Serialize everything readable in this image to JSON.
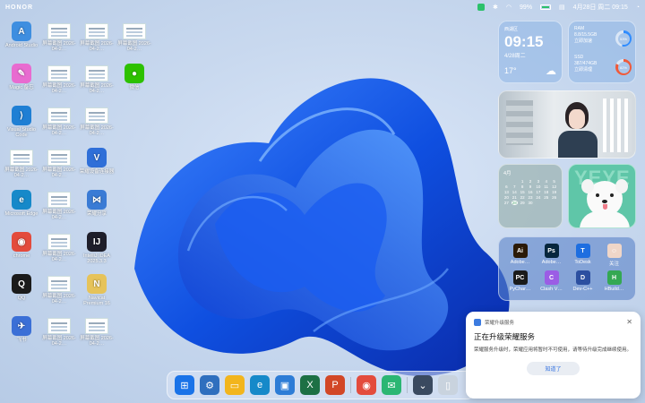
{
  "topbar": {
    "brand": "HONOR",
    "battery": "99%",
    "datetime": "4月28日 周二 09:15"
  },
  "desktop_icons": [
    {
      "label": "Android Studio",
      "icon": "android-studio-icon",
      "color": "#3e8ee0",
      "glyph": "A"
    },
    {
      "label": "屏幕截图 2026-04-2…",
      "icon": "screenshot-thumb",
      "thumb": true
    },
    {
      "label": "屏幕截图 2026-04-2…",
      "icon": "screenshot-thumb",
      "thumb": true
    },
    {
      "label": "屏幕截图 2026-04-2…",
      "icon": "screenshot-thumb",
      "thumb": true
    },
    {
      "label": "Magic 备忘",
      "icon": "magic-notes-icon",
      "color": "#e86bd0",
      "glyph": "✎"
    },
    {
      "label": "屏幕截图 2026-04-2…",
      "icon": "screenshot-thumb",
      "thumb": true
    },
    {
      "label": "屏幕截图 2026-04-2…",
      "icon": "screenshot-thumb",
      "thumb": true
    },
    {
      "label": "微信",
      "icon": "wechat-icon",
      "color": "#2dc100",
      "glyph": "●"
    },
    {
      "label": "Visual Studio Code",
      "icon": "vscode-icon",
      "color": "#1f7fd4",
      "glyph": "⟩"
    },
    {
      "label": "屏幕截图 2026-04-2…",
      "icon": "screenshot-thumb",
      "thumb": true
    },
    {
      "label": "屏幕截图 2026-04-2…",
      "icon": "screenshot-thumb",
      "thumb": true
    },
    {
      "label": "",
      "icon": "empty",
      "thumb": false,
      "hidden": true
    },
    {
      "label": "屏幕截图 2026-04-2…",
      "icon": "screenshot-thumb",
      "thumb": true
    },
    {
      "label": "屏幕截图 2026-04-2…",
      "icon": "screenshot-thumb",
      "thumb": true
    },
    {
      "label": "荣耀设备连接器",
      "icon": "honor-connect-icon",
      "color": "#2f6fd8",
      "glyph": "V"
    },
    {
      "label": "",
      "icon": "empty",
      "thumb": false,
      "hidden": true
    },
    {
      "label": "Microsoft Edge",
      "icon": "edge-icon",
      "color": "#1689c9",
      "glyph": "e"
    },
    {
      "label": "屏幕截图 2026-04-2…",
      "icon": "screenshot-thumb",
      "thumb": true
    },
    {
      "label": "荣耀分享",
      "icon": "honor-share-icon",
      "color": "#3a7bd5",
      "glyph": "⋈"
    },
    {
      "label": "",
      "icon": "empty",
      "thumb": false,
      "hidden": true
    },
    {
      "label": "chrome",
      "icon": "chrome-icon",
      "color": "#e34b3c",
      "glyph": "◉"
    },
    {
      "label": "屏幕截图 2026-04-2…",
      "icon": "screenshot-thumb",
      "thumb": true
    },
    {
      "label": "IntelliJ IDEA 2025.3.3",
      "icon": "intellij-icon",
      "color": "#1e1e2a",
      "glyph": "IJ"
    },
    {
      "label": "",
      "icon": "empty",
      "thumb": false,
      "hidden": true
    },
    {
      "label": "QQ",
      "icon": "qq-icon",
      "color": "#1b1b1b",
      "glyph": "Q"
    },
    {
      "label": "屏幕截图 2026-04-2…",
      "icon": "screenshot-thumb",
      "thumb": true
    },
    {
      "label": "Navicat Premium 16",
      "icon": "navicat-icon",
      "color": "#e6c35a",
      "glyph": "N"
    },
    {
      "label": "",
      "icon": "empty",
      "thumb": false,
      "hidden": true
    },
    {
      "label": "飞书",
      "icon": "feishu-icon",
      "color": "#3b6fd6",
      "glyph": "✈"
    },
    {
      "label": "屏幕截图 2026-04-2…",
      "icon": "screenshot-thumb",
      "thumb": true
    },
    {
      "label": "屏幕截图 2026-04-2…",
      "icon": "screenshot-thumb",
      "thumb": true
    },
    {
      "label": "",
      "icon": "empty",
      "thumb": false,
      "hidden": true
    }
  ],
  "weather": {
    "location": "西湖区",
    "time": "09:15",
    "date": "4/28周二",
    "temp": "17°"
  },
  "system": {
    "ram_label": "RAM",
    "ram_value": "8.8/15.5GB",
    "ram_action": "立即加速",
    "ram_pct": "53%",
    "ram_fill": 0.53,
    "ssd_label": "SSD",
    "ssd_value": "387/474GB",
    "ssd_action": "立即清理",
    "ssd_pct": "82%",
    "ssd_fill": 0.82
  },
  "calendar": {
    "month": "4月",
    "days": [
      "",
      "",
      "1",
      "2",
      "3",
      "4",
      "5",
      "6",
      "7",
      "8",
      "9",
      "10",
      "11",
      "12",
      "13",
      "14",
      "15",
      "16",
      "17",
      "18",
      "19",
      "20",
      "21",
      "22",
      "23",
      "24",
      "25",
      "26",
      "27",
      "28",
      "29",
      "30",
      "",
      "",
      ""
    ],
    "today": "28"
  },
  "photo_widget": {
    "text": "YEYE"
  },
  "apps_widget": [
    {
      "label": "Adobe…",
      "icon": "illustrator-icon",
      "color": "#2b1a07",
      "glyph": "Ai"
    },
    {
      "label": "Adobe…",
      "icon": "photoshop-icon",
      "color": "#06263d",
      "glyph": "Ps"
    },
    {
      "label": "ToDesk",
      "icon": "todesk-icon",
      "color": "#1e6ee0",
      "glyph": "T"
    },
    {
      "label": "关注",
      "icon": "avatar-icon",
      "color": "#f0d6c8",
      "glyph": "☺"
    },
    {
      "label": "PyChar…",
      "icon": "pycharm-icon",
      "color": "#1a1a1a",
      "glyph": "PC"
    },
    {
      "label": "Clash V…",
      "icon": "clash-icon",
      "color": "#9b5de5",
      "glyph": "C"
    },
    {
      "label": "Dev-C++",
      "icon": "devcpp-icon",
      "color": "#2c4fa0",
      "glyph": "D"
    },
    {
      "label": "HBuild…",
      "icon": "hbuilder-icon",
      "color": "#34a853",
      "glyph": "H"
    }
  ],
  "dock": [
    {
      "name": "windows-start-icon",
      "color": "#1a73e8",
      "glyph": "⊞"
    },
    {
      "name": "settings-gear-icon",
      "color": "#2f6fbe",
      "glyph": "⚙"
    },
    {
      "name": "file-explorer-icon",
      "color": "#f2b51d",
      "glyph": "▭"
    },
    {
      "name": "edge-icon",
      "color": "#1689c9",
      "glyph": "e"
    },
    {
      "name": "remote-desktop-icon",
      "color": "#2d7cd6",
      "glyph": "▣"
    },
    {
      "name": "excel-icon",
      "color": "#1d7044",
      "glyph": "X"
    },
    {
      "name": "powerpoint-icon",
      "color": "#d24726",
      "glyph": "P"
    },
    {
      "name": "chrome-icon",
      "color": "#e34b3c",
      "glyph": "◉"
    },
    {
      "name": "green-app-icon",
      "color": "#2bb673",
      "glyph": "✉"
    },
    {
      "name": "chevron-down-icon",
      "color": "#3a4a60",
      "glyph": "⌄"
    },
    {
      "name": "tablet-icon",
      "color": "#c9d3de",
      "glyph": "▯"
    }
  ],
  "toast": {
    "app": "荣耀升级服务",
    "title": "正在升级荣耀服务",
    "body": "荣耀服务升级时，荣耀应用将暂时不可使用，请等待升级完成继续使用。",
    "button": "知道了"
  }
}
